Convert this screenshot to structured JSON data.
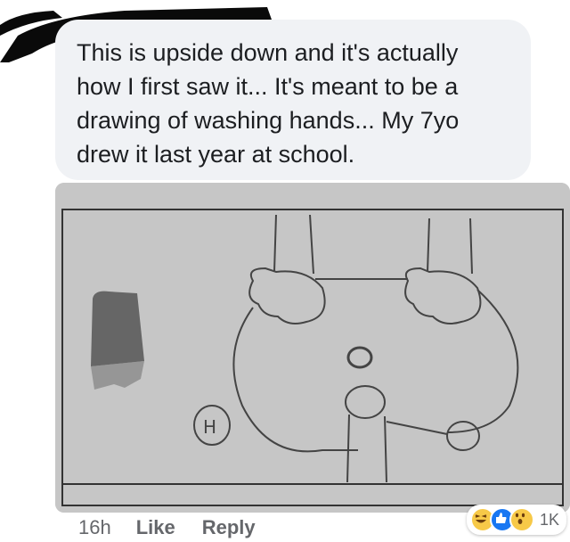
{
  "comment": {
    "text": "This is upside down and it's actually\nhow I first saw it... It's meant to be a\ndrawing of washing hands... My 7yo\ndrew it last year at school."
  },
  "image": {
    "icon": "hand-drawing-image",
    "drawing_label": "H"
  },
  "actions": {
    "time": "16h",
    "like_label": "Like",
    "reply_label": "Reply"
  },
  "reactions": {
    "icons": [
      "haha-icon",
      "like-icon",
      "wow-icon"
    ],
    "count": "1K"
  },
  "colors": {
    "bubble_bg": "#f0f2f5",
    "text": "#1c1e21",
    "meta": "#65676b",
    "like_blue": "#1877f2"
  }
}
